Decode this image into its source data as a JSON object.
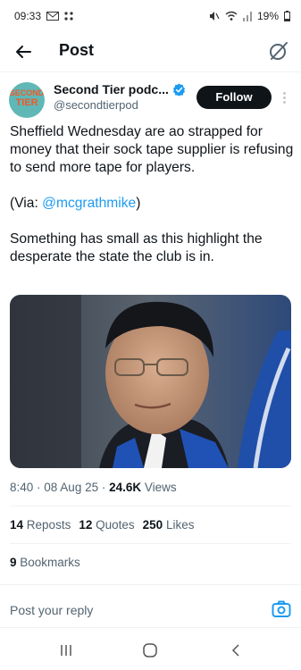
{
  "status_bar": {
    "time": "09:33",
    "battery": "19%"
  },
  "header": {
    "title": "Post"
  },
  "author": {
    "name": "Second Tier podc...",
    "handle": "@secondtierpod",
    "avatar_text": [
      "SECOND",
      "TIER"
    ],
    "follow_label": "Follow"
  },
  "tweet": {
    "line1": "Sheffield Wednesday are ao strapped for money that their sock tape supplier is refusing to send more tape for players.",
    "via_prefix": "(Via: ",
    "via_mention": "@mcgrathmike",
    "via_suffix": ")",
    "line3": "Something has small as this highlight the desperate the state the club is in."
  },
  "meta": {
    "time": "8:40",
    "date": "08 Aug 25",
    "views_count": "24.6K",
    "views_label": "Views"
  },
  "stats": {
    "reposts_count": "14",
    "reposts_label": "Reposts",
    "quotes_count": "12",
    "quotes_label": "Quotes",
    "likes_count": "250",
    "likes_label": "Likes"
  },
  "bookmarks": {
    "count": "9",
    "label": "Bookmarks"
  },
  "reply": {
    "placeholder": "Post your reply"
  },
  "colors": {
    "accent": "#1d9bf0",
    "text": "#0f1419",
    "secondary": "#536471"
  }
}
